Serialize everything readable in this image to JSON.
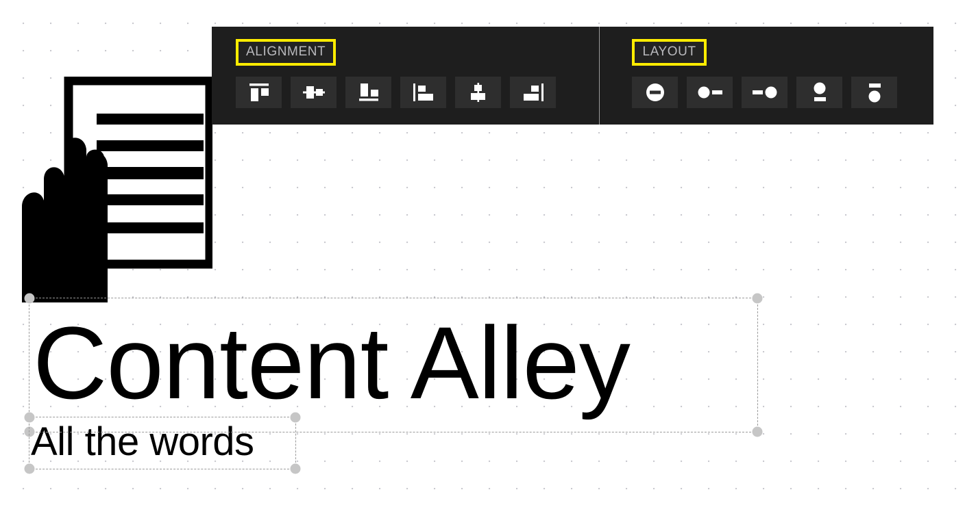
{
  "app": {
    "canvas_background": "#ffffff",
    "grid_dot_color": "#c9c9cf",
    "accent_highlight": "#ffec00",
    "toolbar_background": "#1e1e1e",
    "button_background": "#2e2e2e",
    "label_color": "#b9b9bd",
    "selection_color": "#9a9a9a",
    "handle_color": "#c6c6c6"
  },
  "toolbar": {
    "groups": [
      {
        "label": "ALIGNMENT",
        "label_highlighted": true,
        "buttons": [
          {
            "name": "align-top-icon",
            "title": "Align top"
          },
          {
            "name": "align-center-horizontal-icon",
            "title": "Align horizontal center"
          },
          {
            "name": "align-bottom-icon",
            "title": "Align bottom"
          },
          {
            "name": "align-left-icon",
            "title": "Align left"
          },
          {
            "name": "align-center-vertical-icon",
            "title": "Align vertical center"
          },
          {
            "name": "align-right-icon",
            "title": "Align right"
          }
        ]
      },
      {
        "label": "LAYOUT",
        "label_highlighted": true,
        "buttons": [
          {
            "name": "label-overlay-icon",
            "title": "Label overlay"
          },
          {
            "name": "label-right-icon",
            "title": "Label to the right"
          },
          {
            "name": "label-left-icon",
            "title": "Label to the left"
          },
          {
            "name": "label-below-icon",
            "title": "Label below"
          },
          {
            "name": "label-above-icon",
            "title": "Label above"
          }
        ]
      }
    ]
  },
  "artwork": {
    "name": "hand-holding-document-illustration",
    "document_line_count": 5
  },
  "objects": {
    "title": {
      "text": "Content Alley",
      "selected": true,
      "font_size_px": 150
    },
    "subtitle": {
      "text": "All the words",
      "selected": true,
      "font_size_px": 58
    }
  }
}
